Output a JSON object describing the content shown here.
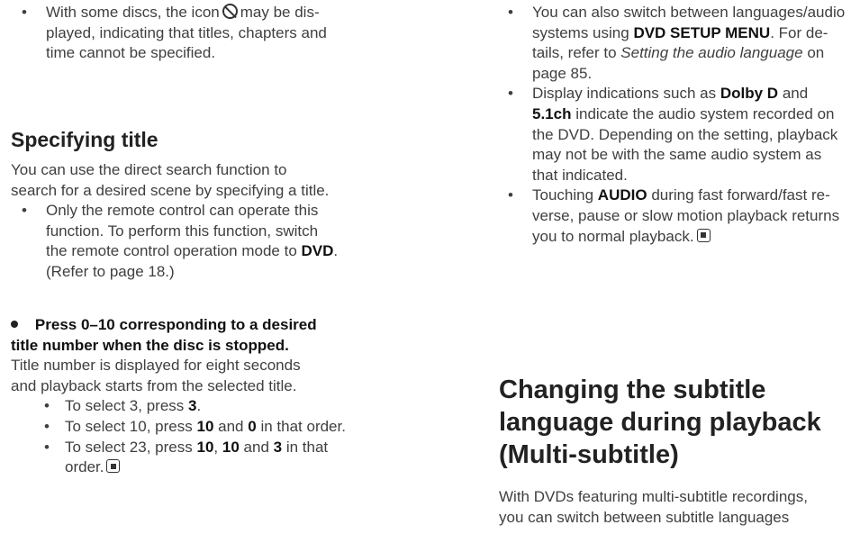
{
  "left": {
    "intro_bullet": {
      "l1a": "With some discs, the icon",
      "l1b": "may be dis-",
      "l2": "played, indicating that titles, chapters and",
      "l3": "time cannot be specified."
    },
    "heading": "Specifying title",
    "para": {
      "l1": "You can use the direct search function to",
      "l2": "search for a desired scene by specifying a title."
    },
    "note": {
      "l1": "Only the remote control can operate this",
      "l2": "function. To perform this function, switch",
      "l3a": "the remote control operation mode to",
      "l3b": "DVD",
      "l3c": ".",
      "l4": "(Refer to page 18.)"
    },
    "step": {
      "l1": "Press 0–10 corresponding to a desired",
      "l2": "title number when the disc is stopped."
    },
    "result": {
      "l1": "Title number is displayed for eight seconds",
      "l2": "and playback starts from the selected title."
    },
    "examples": {
      "e1a": "To select 3, press",
      "e1b": "3",
      "e1c": ".",
      "e2a": "To select 10, press",
      "e2b": "10",
      "e2c": "and",
      "e2d": "0",
      "e2e": "in that order.",
      "e3a": "To select 23, press",
      "e3b": "10",
      "e3c": ",",
      "e3d": "10",
      "e3e": "and",
      "e3f": "3",
      "e3g": "in that",
      "e3h": "order."
    }
  },
  "right": {
    "b1": {
      "l1": "You can also switch between languages/audio",
      "l2a": "systems using",
      "l2b": "DVD SETUP MENU",
      "l2c": ". For de-",
      "l3a": "tails, refer to",
      "l3b": "Setting the audio language",
      "l3c": "on",
      "l4": "page 85."
    },
    "b2": {
      "l1a": "Display indications such as",
      "l1b": "Dolby D",
      "l1c": "and",
      "l2a": "5.1ch",
      "l2b": "indicate the audio system recorded on",
      "l3": "the DVD. Depending on the setting, playback",
      "l4": "may not be with the same audio system as",
      "l5": "that indicated."
    },
    "b3": {
      "l1a": "Touching",
      "l1b": "AUDIO",
      "l1c": "during fast forward/fast re-",
      "l2": "verse, pause or slow motion playback returns",
      "l3": "you to normal playback."
    },
    "heading": {
      "l1": "Changing the subtitle",
      "l2": "language during playback",
      "l3": "(Multi-subtitle)"
    },
    "para": {
      "l1": "With DVDs featuring multi-subtitle recordings,",
      "l2": "you can switch between subtitle languages"
    }
  },
  "icons": [
    "prohibit-icon",
    "stop-icon"
  ],
  "bullet_char": "•"
}
